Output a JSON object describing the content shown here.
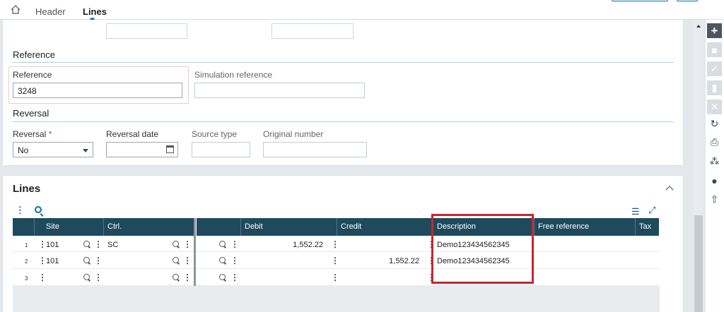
{
  "tabs": {
    "header": "Header",
    "lines": "Lines"
  },
  "reference_section": {
    "title": "Reference",
    "reference_label": "Reference",
    "reference_value": "3248",
    "simulation_label": "Simulation reference",
    "simulation_value": ""
  },
  "reversal_section": {
    "title": "Reversal",
    "reversal_label": "Reversal",
    "required_mark": "*",
    "reversal_value": "No",
    "reversal_date_label": "Reversal date",
    "source_type_label": "Source type",
    "original_number_label": "Original number"
  },
  "lines_section": {
    "title": "Lines",
    "columns": {
      "site": "Site",
      "ctrl": "Ctrl.",
      "debit": "Debit",
      "credit": "Credit",
      "description": "Description",
      "free_reference": "Free reference",
      "tax": "Tax"
    },
    "rows": [
      {
        "num": "1",
        "site": "101",
        "ctrl": "SC",
        "debit": "1,552.22",
        "credit": "",
        "description": "Demo123434562345"
      },
      {
        "num": "2",
        "site": "101",
        "ctrl": "",
        "debit": "",
        "credit": "1,552.22",
        "description": "Demo123434562345"
      },
      {
        "num": "3",
        "site": "",
        "ctrl": "",
        "debit": "",
        "credit": "",
        "description": ""
      }
    ]
  },
  "colors": {
    "accent": "#0d6ea8",
    "grid_header": "#1f4a5e",
    "highlight": "#c9252c"
  }
}
